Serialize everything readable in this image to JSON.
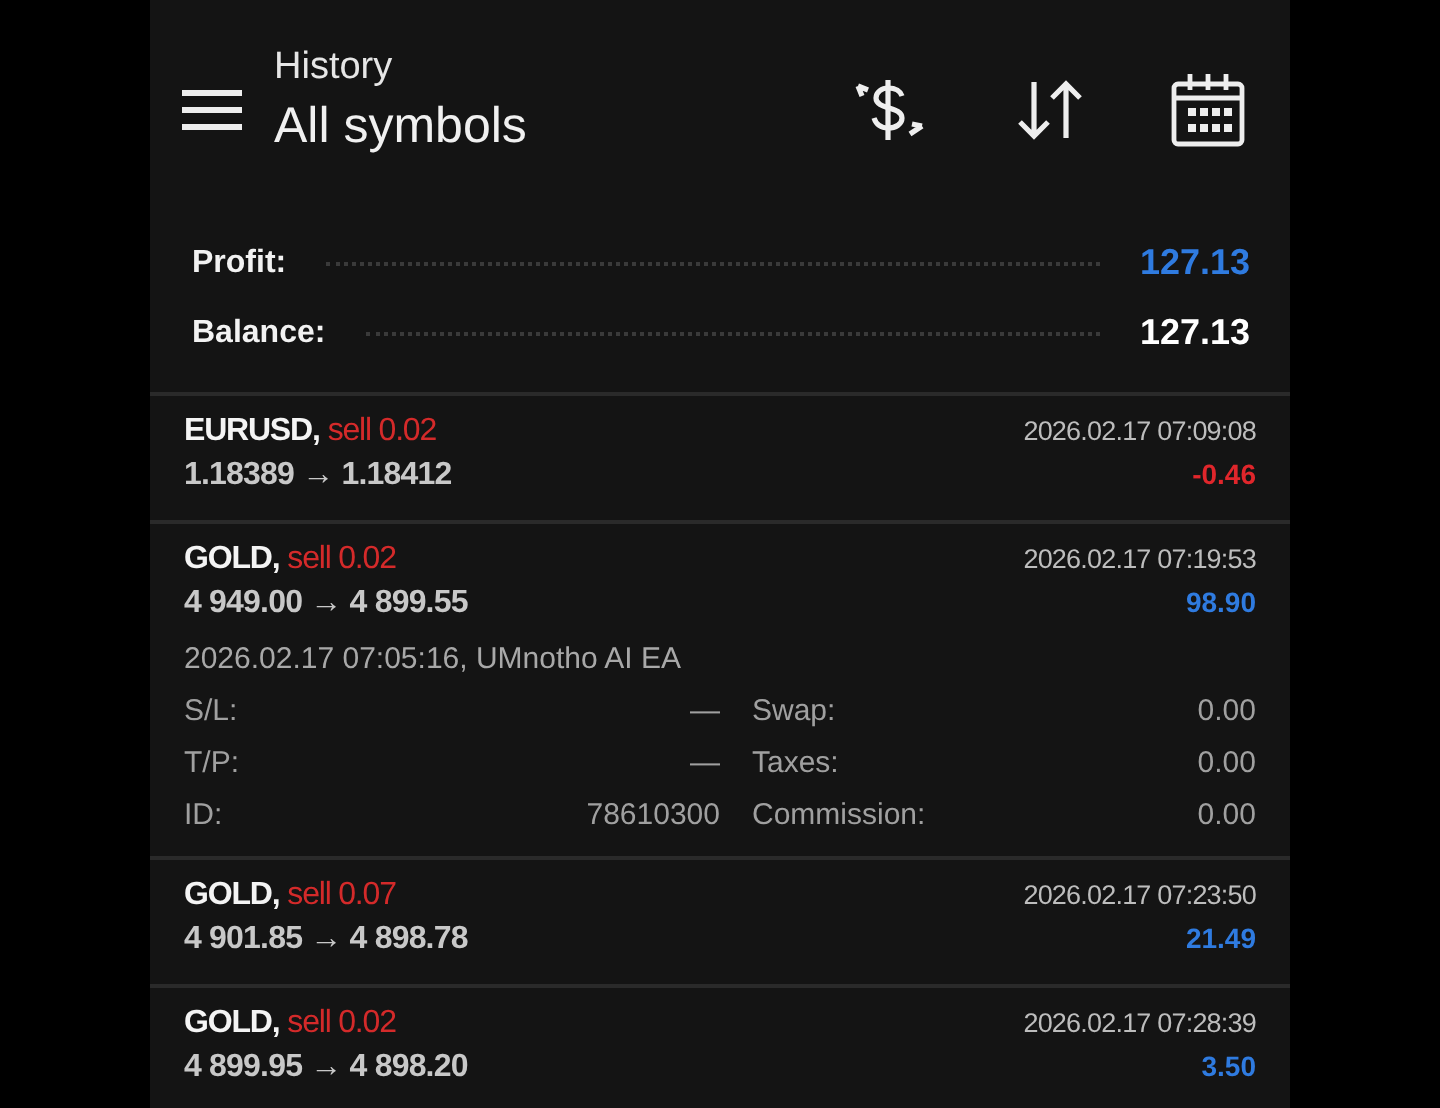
{
  "header": {
    "title": "History",
    "subtitle": "All symbols"
  },
  "summary": [
    {
      "label": "Profit:",
      "value": "127.13",
      "color": "#2f7be0"
    },
    {
      "label": "Balance:",
      "value": "127.13",
      "color": "#ffffff"
    }
  ],
  "trades": [
    {
      "symbol": "EURUSD,",
      "side": "sell 0.02",
      "prices": "1.18389 → 1.18412",
      "time": "2026.02.17 07:09:08",
      "profit": "-0.46",
      "color": "#e0262b"
    },
    {
      "symbol": "GOLD,",
      "side": "sell 0.02",
      "prices": "4 949.00 → 4 899.55",
      "time": "2026.02.17 07:19:53",
      "profit": "98.90",
      "color": "#2f7be0",
      "opened": "2026.02.17 07:05:16, UMnotho AI EA",
      "details": [
        {
          "label": "S/L:",
          "value": "—"
        },
        {
          "label": "Swap:",
          "value": "0.00"
        },
        {
          "label": "T/P:",
          "value": "—"
        },
        {
          "label": "Taxes:",
          "value": "0.00"
        },
        {
          "label": "ID:",
          "value": "78610300"
        },
        {
          "label": "Commission:",
          "value": "0.00"
        }
      ]
    },
    {
      "symbol": "GOLD,",
      "side": "sell 0.07",
      "prices": "4 901.85 → 4 898.78",
      "time": "2026.02.17 07:23:50",
      "profit": "21.49",
      "color": "#2f7be0"
    },
    {
      "symbol": "GOLD,",
      "side": "sell 0.02",
      "prices": "4 899.95 → 4 898.20",
      "time": "2026.02.17 07:28:39",
      "profit": "3.50",
      "color": "#2f7be0"
    }
  ]
}
